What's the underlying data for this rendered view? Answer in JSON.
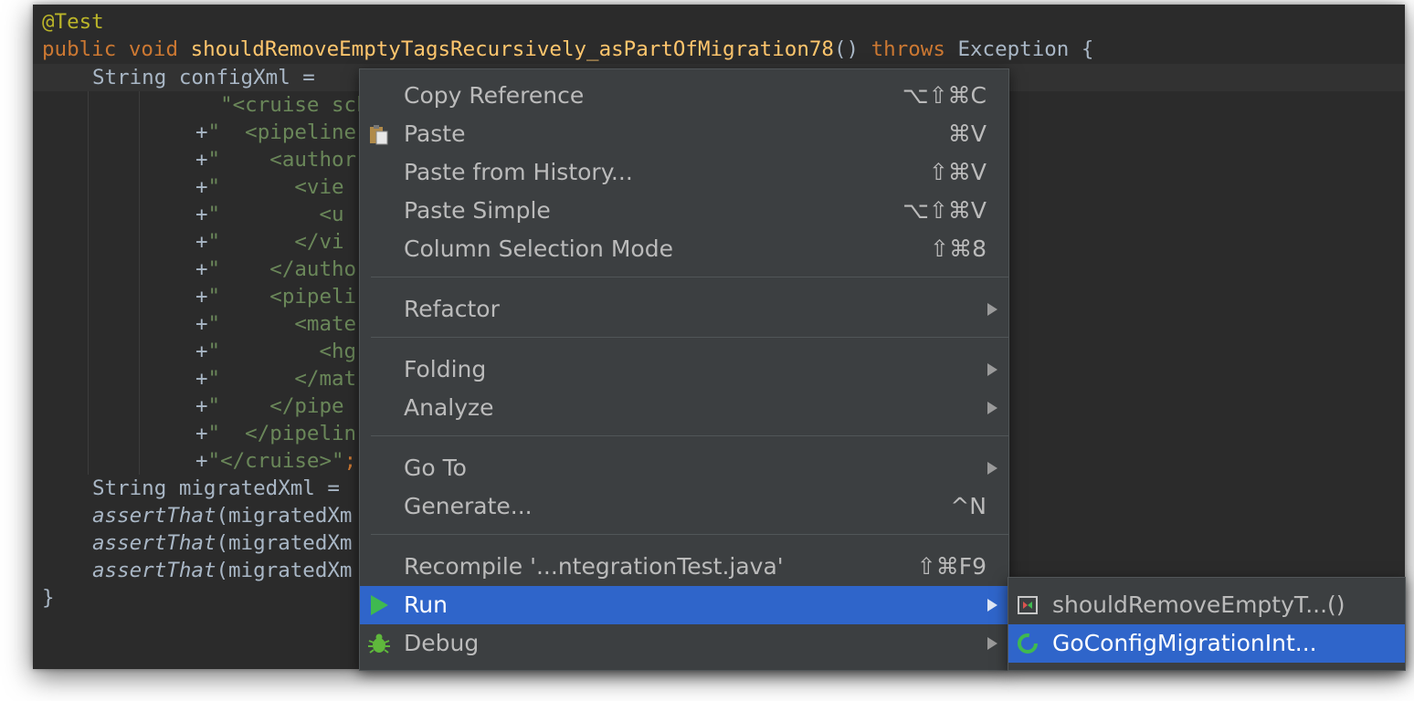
{
  "code": {
    "annotation": "@Test",
    "sig_public": "public",
    "sig_void": "void",
    "sig_method": "shouldRemoveEmptyTagsRecursively_asPartOfMigration78",
    "sig_parens": "()",
    "sig_throws": "throws",
    "sig_exception": "Exception {",
    "config_decl": "String configXml =",
    "xml_lines": [
      {
        "op": "",
        "str": "\"<cruise sche"
      },
      {
        "op": "+",
        "str": "\"  <pipeline"
      },
      {
        "op": "+",
        "str": "\"    <author"
      },
      {
        "op": "+",
        "str": "\"      <vie"
      },
      {
        "op": "+",
        "str": "\"        <u"
      },
      {
        "op": "+",
        "str": "\"      </vi"
      },
      {
        "op": "+",
        "str": "\"    </autho"
      },
      {
        "op": "+",
        "str": "\"    <pipeli"
      },
      {
        "op": "+",
        "str": "\"      <mate"
      },
      {
        "op": "+",
        "str": "\"        <hg"
      },
      {
        "op": "+",
        "str": "\"      </mat"
      },
      {
        "op": "+",
        "str": "\"    </pipe"
      },
      {
        "op": "+",
        "str": "\"  </pipelin"
      },
      {
        "op": "+",
        "str": "\"</cruise>\""
      }
    ],
    "semicolon": ";",
    "migrated_decl": "String migratedXml =",
    "assert_fn": "assertThat",
    "assert_arg": "(migratedXm",
    "closing_brace": "}"
  },
  "menu": {
    "items": [
      {
        "label": "Copy Reference",
        "shortcut": "⌥⇧⌘C"
      },
      {
        "label": "Paste",
        "shortcut": "⌘V"
      },
      {
        "label": "Paste from History...",
        "shortcut": "⇧⌘V"
      },
      {
        "label": "Paste Simple",
        "shortcut": "⌥⇧⌘V"
      },
      {
        "label": "Column Selection Mode",
        "shortcut": "⇧⌘8"
      },
      {
        "label": "Refactor"
      },
      {
        "label": "Folding"
      },
      {
        "label": "Analyze"
      },
      {
        "label": "Go To"
      },
      {
        "label": "Generate...",
        "shortcut": "^N"
      },
      {
        "label": "Recompile '...ntegrationTest.java'",
        "shortcut": "⇧⌘F9"
      },
      {
        "label": "Run"
      },
      {
        "label": "Debug"
      }
    ],
    "selected": "Run"
  },
  "submenu": {
    "items": [
      {
        "label": "shouldRemoveEmptyT...()"
      },
      {
        "label": "GoConfigMigrationInt..."
      }
    ],
    "selected": "GoConfigMigrationInt..."
  },
  "colors": {
    "editor_bg": "#2b2b2b",
    "menu_bg": "#3c3f41",
    "selection": "#2f65ca",
    "keyword": "#cc7832",
    "method": "#ffc66d",
    "string": "#6a8759",
    "annotation": "#bbb529"
  }
}
